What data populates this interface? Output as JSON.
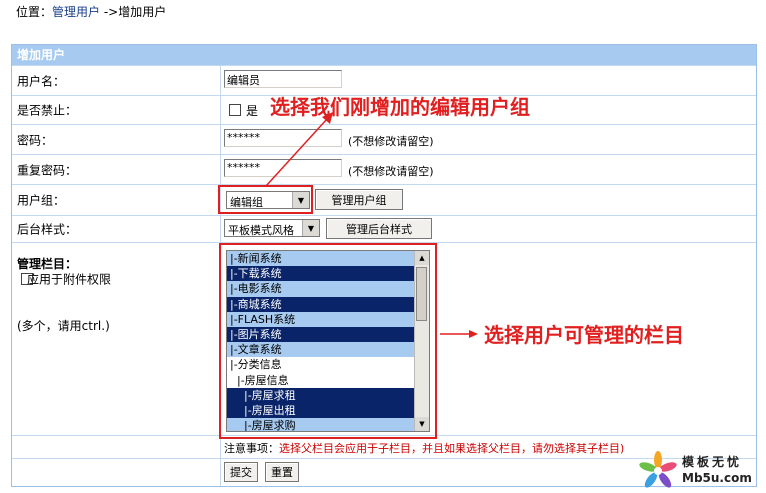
{
  "breadcrumb": {
    "prefix": "位置：",
    "link": "管理用户",
    "sep": " ->",
    "current": "增加用户"
  },
  "panel": {
    "title": "增加用户"
  },
  "form": {
    "username": {
      "label": "用户名：",
      "value": "编辑员"
    },
    "disabled": {
      "label": "是否禁止：",
      "option": "是"
    },
    "password": {
      "label": "密码：",
      "value": "******",
      "hint": "(不想修改请留空)"
    },
    "password_repeat": {
      "label": "重复密码：",
      "value": "******",
      "hint": "(不想修改请留空)"
    },
    "group": {
      "label": "用户组：",
      "selected": "编辑组",
      "manage_button": "管理用户组"
    },
    "style": {
      "label": "后台样式：",
      "selected": "平板模式风格",
      "manage_button": "管理后台样式"
    },
    "columns": {
      "label": "管理栏目：",
      "attach_option": "应用于附件权限",
      "multi_hint": "(多个，请用ctrl.)",
      "options": [
        {
          "text": "|-新闻系统",
          "state": "light"
        },
        {
          "text": "|-下载系统",
          "state": "dark"
        },
        {
          "text": "|-电影系统",
          "state": "light"
        },
        {
          "text": "|-商城系统",
          "state": "dark"
        },
        {
          "text": "|-FLASH系统",
          "state": "light"
        },
        {
          "text": "|-图片系统",
          "state": "dark"
        },
        {
          "text": "|-文章系统",
          "state": "light"
        },
        {
          "text": "|-分类信息",
          "state": "none"
        },
        {
          "text": "  |-房屋信息",
          "state": "none"
        },
        {
          "text": "    |-房屋求租",
          "state": "dark"
        },
        {
          "text": "    |-房屋出租",
          "state": "dark"
        },
        {
          "text": "    |-房屋求购",
          "state": "light"
        }
      ]
    },
    "note": {
      "prefix": "注意事项：",
      "text": "选择父栏目会应用于子栏目，并且如果选择父栏目，请勿选择其子栏目)"
    },
    "submit_button": "提交",
    "reset_button": "重置"
  },
  "annotations": {
    "group_callout": "选择我们刚增加的编辑用户组",
    "columns_callout": "选择用户可管理的栏目",
    "color": "#e02020"
  },
  "watermark": {
    "line1": "模板无忧",
    "line2": "Mb5u.com"
  }
}
